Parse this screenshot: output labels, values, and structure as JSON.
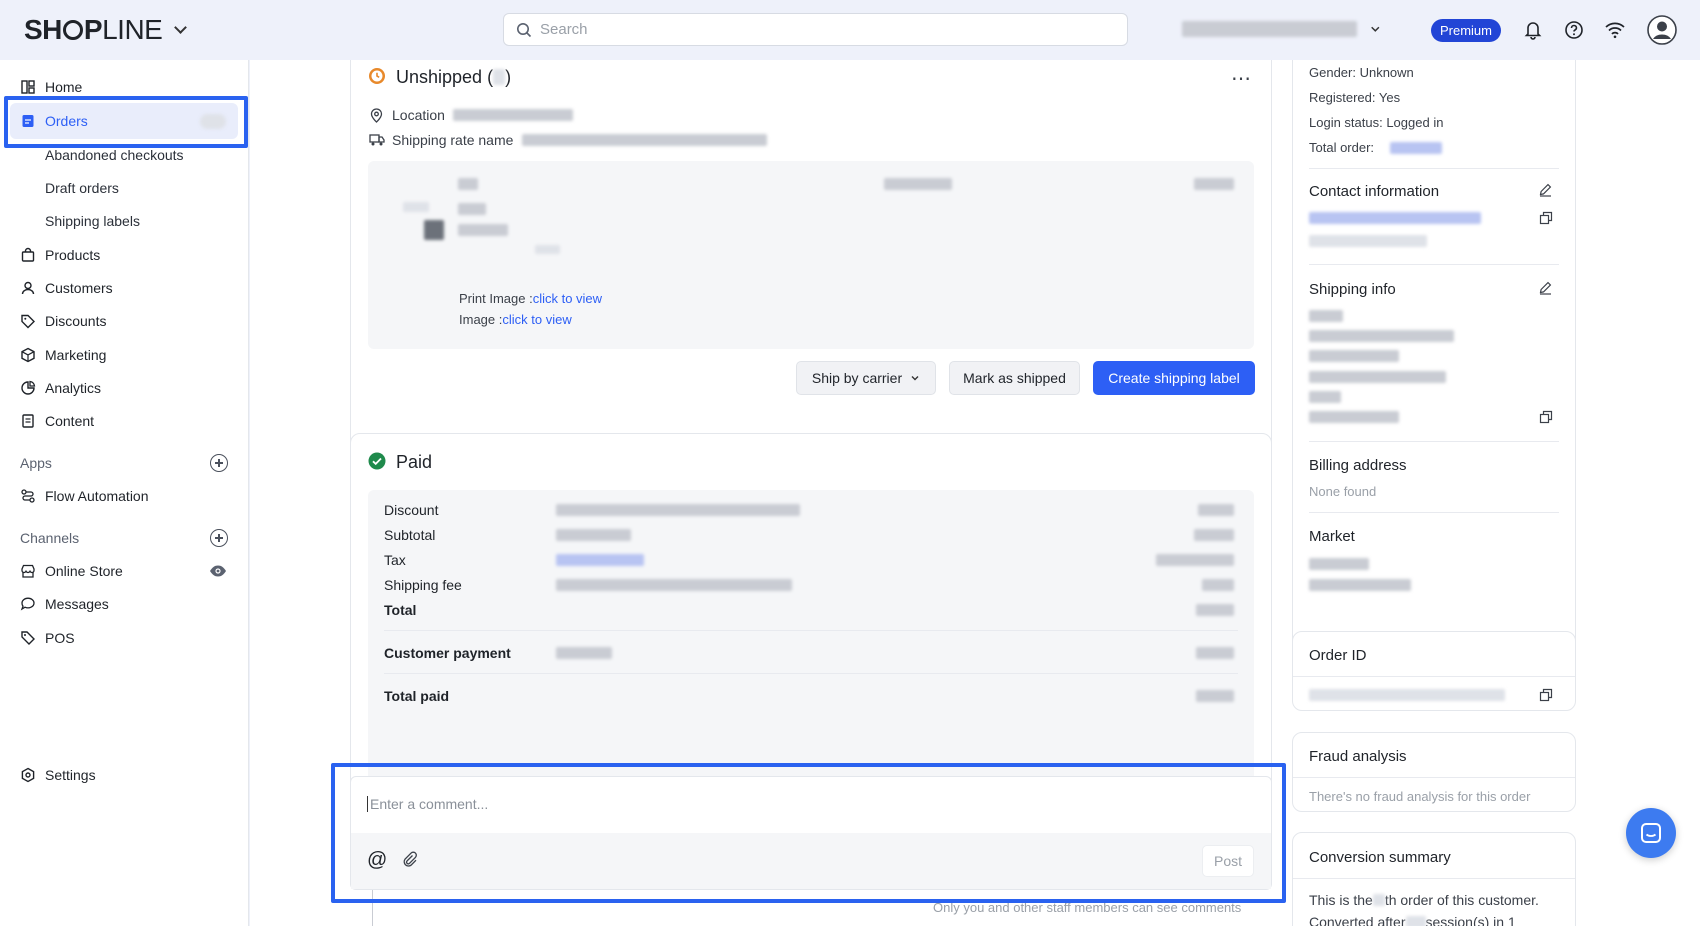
{
  "header": {
    "logo_bold": "SH",
    "logo_o": "O",
    "logo_p": "P",
    "logo_rest": "LINE",
    "search_placeholder": "Search",
    "plan_badge": "Premium",
    "icons": [
      "chevron-down-icon",
      "search-icon",
      "bell-icon",
      "help-icon",
      "wifi-icon",
      "user-avatar-icon"
    ]
  },
  "sidebar": {
    "items": [
      {
        "label": "Home",
        "icon": "home-icon"
      },
      {
        "label": "Orders",
        "icon": "orders-icon"
      },
      {
        "label": "Abandoned checkouts"
      },
      {
        "label": "Draft orders"
      },
      {
        "label": "Shipping labels"
      },
      {
        "label": "Products",
        "icon": "bag-icon"
      },
      {
        "label": "Customers",
        "icon": "person-icon"
      },
      {
        "label": "Discounts",
        "icon": "tag-icon"
      },
      {
        "label": "Marketing",
        "icon": "cube-icon"
      },
      {
        "label": "Analytics",
        "icon": "chart-icon"
      },
      {
        "label": "Content",
        "icon": "document-icon"
      }
    ],
    "apps_label": "Apps",
    "apps": [
      {
        "label": "Flow Automation",
        "icon": "flow-icon"
      }
    ],
    "channels_label": "Channels",
    "channels": [
      {
        "label": "Online Store",
        "icon": "store-icon"
      },
      {
        "label": "Messages",
        "icon": "message-icon"
      },
      {
        "label": "POS",
        "icon": "pos-icon"
      }
    ],
    "settings_label": "Settings"
  },
  "unshipped": {
    "title": "Unshipped (",
    "title_end": ")",
    "location_label": "Location",
    "shipping_rate_label": "Shipping rate name",
    "print_image_label": "Print Image :",
    "image_label": "Image :",
    "link_text": "click to view",
    "ship_by_carrier": "Ship by carrier",
    "mark_as_shipped": "Mark as shipped",
    "create_label": "Create shipping label"
  },
  "paid": {
    "title": "Paid",
    "rows": [
      "Discount",
      "Subtotal",
      "Tax",
      "Shipping fee",
      "Total"
    ],
    "customer_payment": "Customer payment",
    "total_paid": "Total paid"
  },
  "comment": {
    "placeholder": "Enter a comment...",
    "post": "Post",
    "note": "Only you and other staff members can see comments"
  },
  "customer": {
    "gender": "Gender: Unknown",
    "registered": "Registered: Yes",
    "login_status": "Login status: Logged in",
    "total_order": "Total order:",
    "contact_title": "Contact information",
    "shipping_title": "Shipping info",
    "billing_title": "Billing address",
    "billing_value": "None found",
    "market_title": "Market"
  },
  "order_id": {
    "title": "Order ID"
  },
  "fraud": {
    "title": "Fraud analysis",
    "text": "There's no fraud analysis for this order"
  },
  "conversion": {
    "title": "Conversion summary",
    "line1a": "This is the",
    "line1b": "th order of this customer.",
    "line2a": "Converted after",
    "line2b": "session(s) in 1"
  }
}
